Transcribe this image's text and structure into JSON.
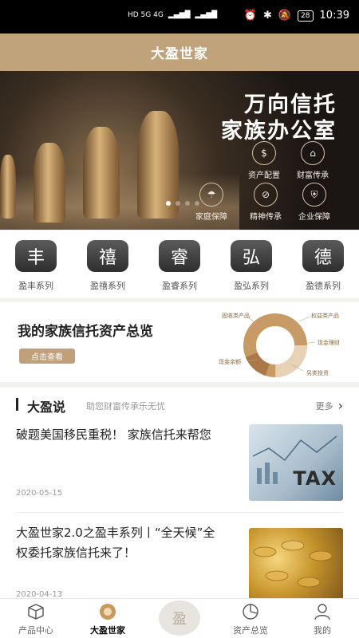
{
  "status_bar": {
    "network": "HD 5G 4G",
    "battery": "28",
    "time": "10:39"
  },
  "header": {
    "title": "大盈世家"
  },
  "banner": {
    "title_line1": "万向信托",
    "title_line2": "家族办公室",
    "features": [
      "资产配置",
      "财富传承",
      "家庭保障",
      "精神传承",
      "企业保障"
    ],
    "dots_total": 4,
    "dots_active": 1
  },
  "series": [
    {
      "char": "丰",
      "label": "盈丰系列"
    },
    {
      "char": "禧",
      "label": "盈禧系列"
    },
    {
      "char": "睿",
      "label": "盈睿系列"
    },
    {
      "char": "弘",
      "label": "盈弘系列"
    },
    {
      "char": "德",
      "label": "盈德系列"
    }
  ],
  "overview": {
    "title": "我的家族信托资产总览",
    "button": "点击查看",
    "chart_labels": [
      "固收类产品",
      "权益类产品",
      "现金理财",
      "另类投资",
      "现金余额"
    ]
  },
  "news_section": {
    "title": "大盈说",
    "subtitle": "助您财富传承乐无忧",
    "more": "更多"
  },
  "articles": [
    {
      "title": "破题美国移民重税！ 家族信托来帮您",
      "date": "2020-05-15",
      "thumb_text": "TAX"
    },
    {
      "title": "大盈世家2.0之盈丰系列丨“全天候”全权委托家族信托来了！",
      "date": "2020-04-13"
    }
  ],
  "tabs": [
    {
      "label": "产品中心",
      "icon": "box-icon"
    },
    {
      "label": "大盈世家",
      "icon": "gold-coin-icon"
    },
    {
      "label": "",
      "icon": "center-logo-icon"
    },
    {
      "label": "资产总览",
      "icon": "pie-icon"
    },
    {
      "label": "我的",
      "icon": "user-icon"
    }
  ],
  "colors": {
    "brand_gold": "#c0a27b",
    "dark": "#222222"
  }
}
